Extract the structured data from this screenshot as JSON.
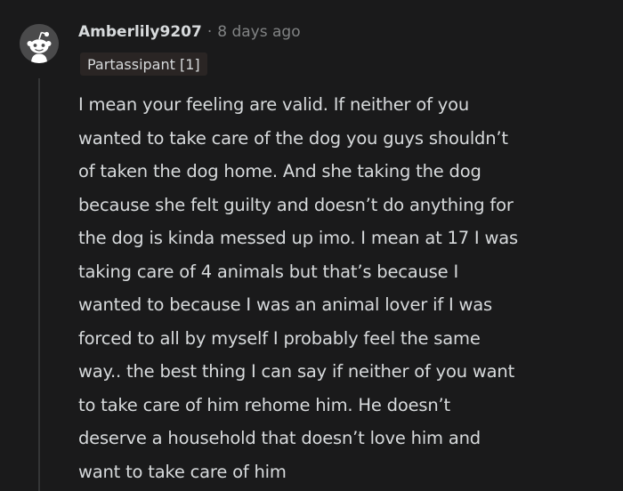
{
  "comment": {
    "author": "Amberlily9207",
    "separator": "·",
    "timestamp": "8 days ago",
    "flair": "Partassipant [1]",
    "avatar_icon": "reddit-snoo-icon",
    "body": "I mean your feeling are valid. If neither of you\nwanted to take care of the dog you guys shouldn’t\nof taken the dog home. And she taking the dog\nbecause she felt guilty and doesn’t do anything for\nthe dog is kinda messed up imo. I mean at 17 I was\ntaking care of 4 animals but that’s because I\nwanted to because I was an animal lover if I was\nforced to all by myself I probably feel the same\nway.. the best thing I can say if neither of you want\nto take care of him rehome him. He doesn’t\ndeserve a household that doesn’t love him and\nwant to take care of him"
  },
  "colors": {
    "background": "#1a1a1b",
    "text": "#d7dadc",
    "muted": "#818384",
    "flair_bg": "#2a2524",
    "thread_line": "#343536",
    "avatar_bg": "#4a4a4b"
  }
}
